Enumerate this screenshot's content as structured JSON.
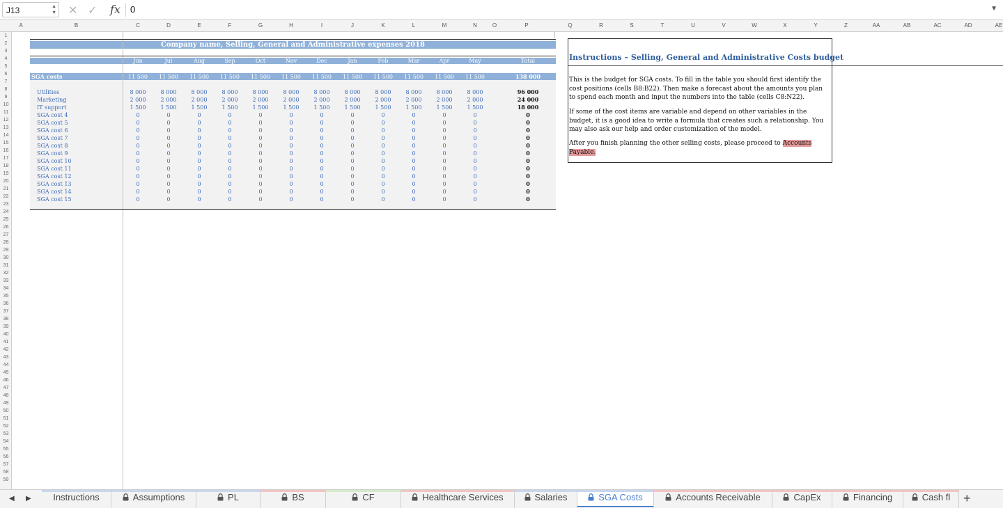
{
  "formula_bar": {
    "name_box": "J13",
    "formula": "0",
    "fx_label": "fx"
  },
  "columns": [
    "A",
    "B",
    "C",
    "D",
    "E",
    "F",
    "G",
    "H",
    "I",
    "J",
    "K",
    "L",
    "M",
    "N",
    "O",
    "P",
    "Q",
    "R",
    "S",
    "T",
    "U",
    "V",
    "W",
    "X",
    "Y",
    "Z",
    "AA",
    "AB",
    "AC",
    "AD",
    "AE"
  ],
  "rows_count": 59,
  "sheet": {
    "title": "Company name, Selling, General and Administrative expenses 2018",
    "months": [
      "Jun",
      "Jul",
      "Aug",
      "Sep",
      "Oct",
      "Nov",
      "Dec",
      "Jan",
      "Feb",
      "Mar",
      "Apr",
      "May"
    ],
    "total_header": "Total",
    "sga_costs": {
      "label": "SGA costs",
      "values": [
        "11 500",
        "11 500",
        "11 500",
        "11 500",
        "11 500",
        "11 500",
        "11 500",
        "11 500",
        "11 500",
        "11 500",
        "11 500",
        "11 500"
      ],
      "total": "138 000"
    },
    "items": [
      {
        "label": "Utilities",
        "values": [
          "8 000",
          "8 000",
          "8 000",
          "8 000",
          "8 000",
          "8 000",
          "8 000",
          "8 000",
          "8 000",
          "8 000",
          "8 000",
          "8 000"
        ],
        "total": "96 000"
      },
      {
        "label": "Marketing",
        "values": [
          "2 000",
          "2 000",
          "2 000",
          "2 000",
          "2 000",
          "2 000",
          "2 000",
          "2 000",
          "2 000",
          "2 000",
          "2 000",
          "2 000"
        ],
        "total": "24 000"
      },
      {
        "label": "IT support",
        "values": [
          "1 500",
          "1 500",
          "1 500",
          "1 500",
          "1 500",
          "1 500",
          "1 500",
          "1 500",
          "1 500",
          "1 500",
          "1 500",
          "1 500"
        ],
        "total": "18 000"
      },
      {
        "label": "SGA cost 4",
        "values": [
          "0",
          "0",
          "0",
          "0",
          "0",
          "0",
          "0",
          "0",
          "0",
          "0",
          "0",
          "0"
        ],
        "total": "0"
      },
      {
        "label": "SGA cost 5",
        "values": [
          "0",
          "0",
          "0",
          "0",
          "0",
          "0",
          "0",
          "0",
          "0",
          "0",
          "0",
          "0"
        ],
        "total": "0"
      },
      {
        "label": "SGA cost 6",
        "values": [
          "0",
          "0",
          "0",
          "0",
          "0",
          "0",
          "0",
          "0",
          "0",
          "0",
          "0",
          "0"
        ],
        "total": "0"
      },
      {
        "label": "SGA cost 7",
        "values": [
          "0",
          "0",
          "0",
          "0",
          "0",
          "0",
          "0",
          "0",
          "0",
          "0",
          "0",
          "0"
        ],
        "total": "0"
      },
      {
        "label": "SGA cost 8",
        "values": [
          "0",
          "0",
          "0",
          "0",
          "0",
          "0",
          "0",
          "0",
          "0",
          "0",
          "0",
          "0"
        ],
        "total": "0"
      },
      {
        "label": "SGA cost 9",
        "values": [
          "0",
          "0",
          "0",
          "0",
          "0",
          "0",
          "0",
          "0",
          "0",
          "0",
          "0",
          "0"
        ],
        "total": "0"
      },
      {
        "label": "SGA cost 10",
        "values": [
          "0",
          "0",
          "0",
          "0",
          "0",
          "0",
          "0",
          "0",
          "0",
          "0",
          "0",
          "0"
        ],
        "total": "0"
      },
      {
        "label": "SGA cost 11",
        "values": [
          "0",
          "0",
          "0",
          "0",
          "0",
          "0",
          "0",
          "0",
          "0",
          "0",
          "0",
          "0"
        ],
        "total": "0"
      },
      {
        "label": "SGA cost 12",
        "values": [
          "0",
          "0",
          "0",
          "0",
          "0",
          "0",
          "0",
          "0",
          "0",
          "0",
          "0",
          "0"
        ],
        "total": "0"
      },
      {
        "label": "SGA cost 13",
        "values": [
          "0",
          "0",
          "0",
          "0",
          "0",
          "0",
          "0",
          "0",
          "0",
          "0",
          "0",
          "0"
        ],
        "total": "0"
      },
      {
        "label": "SGA cost 14",
        "values": [
          "0",
          "0",
          "0",
          "0",
          "0",
          "0",
          "0",
          "0",
          "0",
          "0",
          "0",
          "0"
        ],
        "total": "0"
      },
      {
        "label": "SGA cost 15",
        "values": [
          "0",
          "0",
          "0",
          "0",
          "0",
          "0",
          "0",
          "0",
          "0",
          "0",
          "0",
          "0"
        ],
        "total": "0"
      }
    ]
  },
  "instructions": {
    "title": "Instructions – Selling, General and Administrative Costs budget",
    "p1": "This is the budget for SGA costs. To fill in the table you should first identify the cost positions (cells B8:B22). Then make a forecast about the amounts you plan to spend each month and input the numbers into the table (cells C8:N22).",
    "p2": "If some of the cost items are variable and depend on other variables in the budget, it is a good idea to write a formula that creates such a relationship. You may also ask our help and order customization of the model.",
    "p3_prefix": "After you finish planning the other selling costs, please proceed to ",
    "p3_link_1": "Accounts",
    "p3_link_2": "Payable."
  },
  "tabs": [
    {
      "label": "Instructions",
      "locked": false,
      "color": "#c9d7ee",
      "active": false
    },
    {
      "label": "Assumptions",
      "locked": true,
      "color": "#c9d7ee",
      "active": false
    },
    {
      "label": "PL",
      "locked": true,
      "color": "#c9d7ee",
      "active": false
    },
    {
      "label": "BS",
      "locked": true,
      "color": "#f2c4c4",
      "active": false
    },
    {
      "label": "CF",
      "locked": true,
      "color": "#d6ebc9",
      "active": false
    },
    {
      "label": "Healthcare Services",
      "locked": true,
      "color": "#f2c4c4",
      "active": false
    },
    {
      "label": "Salaries",
      "locked": true,
      "color": "#c9d7ee",
      "active": false
    },
    {
      "label": "SGA Costs",
      "locked": true,
      "color": "#c9d7ee",
      "active": true
    },
    {
      "label": "Accounts Receivable",
      "locked": true,
      "color": "#f2c4c4",
      "active": false
    },
    {
      "label": "CapEx",
      "locked": true,
      "color": "#f2c4c4",
      "active": false
    },
    {
      "label": "Financing",
      "locked": true,
      "color": "#f2c4c4",
      "active": false
    },
    {
      "label": "Cash fl",
      "locked": true,
      "color": "#f2c4c4",
      "active": false
    }
  ],
  "add_tab_label": "+"
}
